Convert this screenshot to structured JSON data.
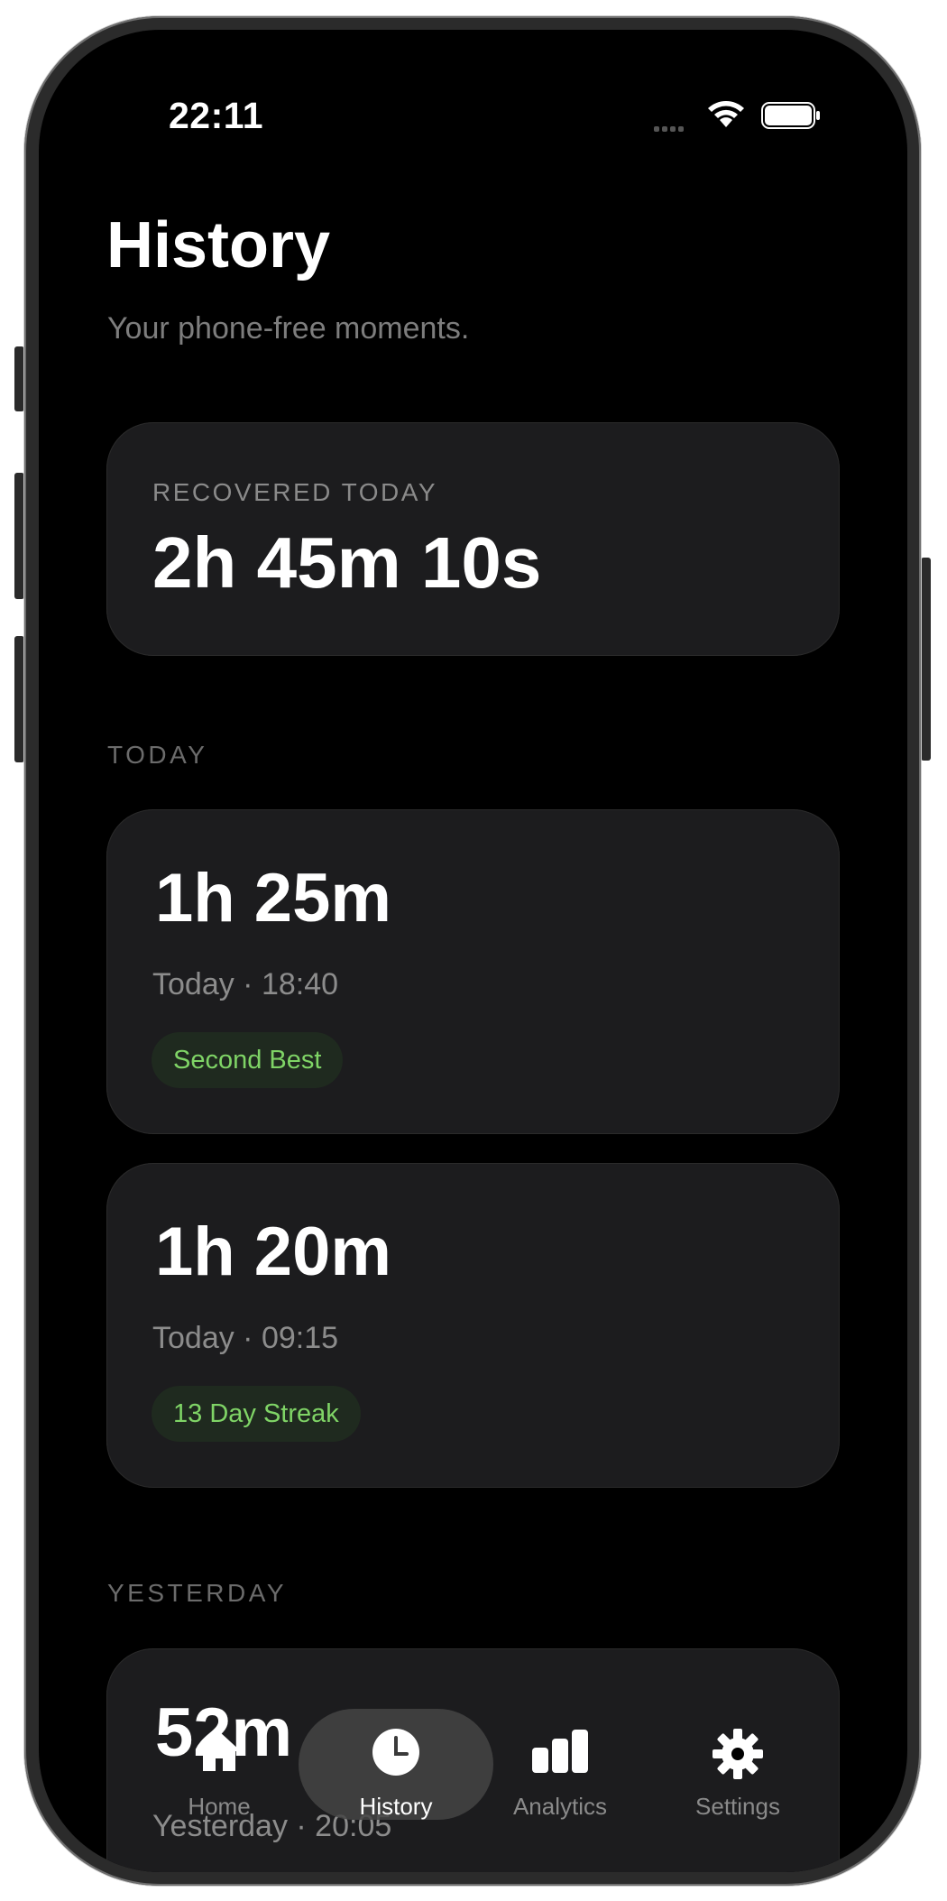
{
  "status_bar": {
    "time": "22:11"
  },
  "header": {
    "title": "History",
    "subtitle": "Your phone-free moments."
  },
  "summary": {
    "label": "RECOVERED TODAY",
    "value": "2h 45m 10s"
  },
  "sections": [
    {
      "label": "TODAY",
      "sessions": [
        {
          "duration": "1h 25m",
          "meta": "Today · 18:40",
          "badge": "Second Best"
        },
        {
          "duration": "1h 20m",
          "meta": "Today · 09:15",
          "badge": "13 Day Streak"
        }
      ]
    },
    {
      "label": "YESTERDAY",
      "sessions": [
        {
          "duration": "52m",
          "meta": "Yesterday · 20:05"
        }
      ]
    }
  ],
  "tabbar": {
    "tabs": [
      {
        "label": "Home",
        "icon": "house-icon"
      },
      {
        "label": "History",
        "icon": "clock-icon",
        "active": true
      },
      {
        "label": "Analytics",
        "icon": "bar-chart-icon"
      },
      {
        "label": "Settings",
        "icon": "gear-icon"
      }
    ]
  },
  "colors": {
    "background": "#000000",
    "card": "#1c1c1e",
    "badge_bg": "#1f2a1f",
    "badge_text": "#7fd466",
    "secondary_text": "#8c8c8c"
  }
}
